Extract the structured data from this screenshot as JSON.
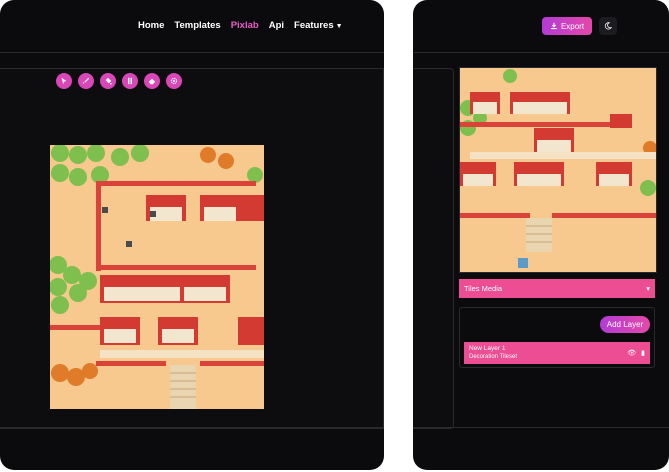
{
  "nav": {
    "items": [
      {
        "label": "Home",
        "active": false
      },
      {
        "label": "Templates",
        "active": false
      },
      {
        "label": "Pixlab",
        "active": true
      },
      {
        "label": "Api",
        "active": false
      },
      {
        "label": "Features",
        "active": false
      }
    ]
  },
  "toolbar": {
    "tools": [
      "cursor-icon",
      "brush-icon",
      "fill-icon",
      "columns-icon",
      "eraser-icon",
      "settings-icon"
    ]
  },
  "right": {
    "export_label": "Export",
    "theme_icon": "moon-icon",
    "tiles_dropdown": "Tiles Media",
    "add_layer_label": "Add Layer",
    "layer": {
      "name": "New Layer 1",
      "tileset": "Decoration Tileset"
    }
  },
  "colors": {
    "accent": "#d946b8",
    "pink": "#ec4d93",
    "bg": "#0b0b0d"
  }
}
